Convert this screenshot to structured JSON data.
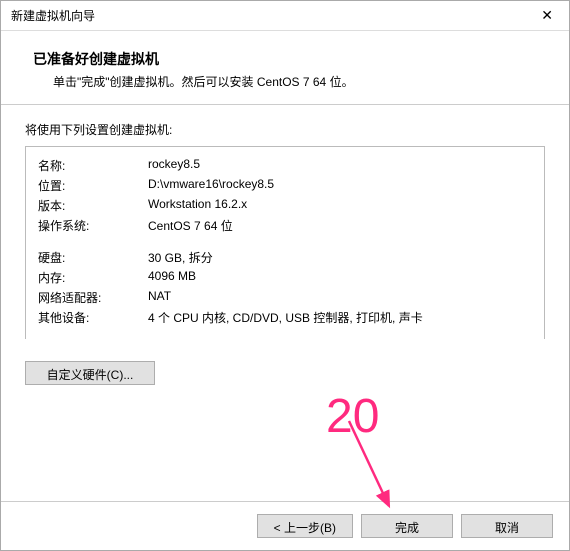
{
  "titlebar": {
    "title": "新建虚拟机向导"
  },
  "header": {
    "heading": "已准备好创建虚拟机",
    "subtext": "单击\"完成\"创建虚拟机。然后可以安装 CentOS 7 64 位。"
  },
  "settings_intro": "将使用下列设置创建虚拟机:",
  "settings": {
    "name_k": "名称:",
    "name_v": "rockey8.5",
    "location_k": "位置:",
    "location_v": "D:\\vmware16\\rockey8.5",
    "version_k": "版本:",
    "version_v": "Workstation 16.2.x",
    "os_k": "操作系统:",
    "os_v": "CentOS 7 64 位",
    "disk_k": "硬盘:",
    "disk_v": "30 GB, 拆分",
    "memory_k": "内存:",
    "memory_v": "4096 MB",
    "net_k": "网络适配器:",
    "net_v": "NAT",
    "other_k": "其他设备:",
    "other_v": "4 个 CPU 内核, CD/DVD, USB 控制器, 打印机, 声卡"
  },
  "buttons": {
    "customize": "自定义硬件(C)...",
    "back": "< 上一步(B)",
    "finish": "完成",
    "cancel": "取消"
  },
  "annotation": {
    "number": "20"
  }
}
